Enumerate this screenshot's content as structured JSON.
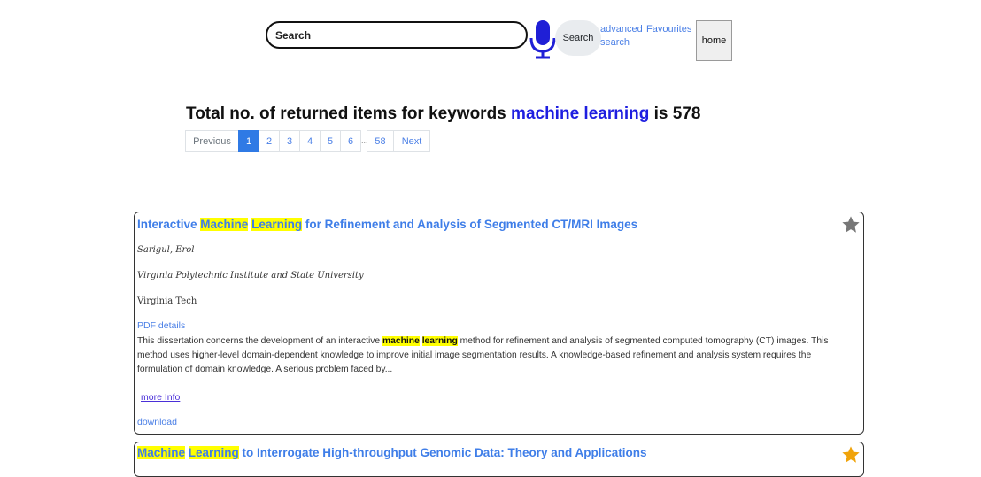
{
  "search": {
    "placeholder": "Search",
    "button_label": "Search"
  },
  "nav": {
    "advanced_search": "advanced search",
    "favourites": "Favourites",
    "home": "home"
  },
  "summary": {
    "prefix": "Total no. of returned items for keywords",
    "keyword": "machine learning",
    "connector": "is",
    "count": "578"
  },
  "pagination": {
    "previous": "Previous",
    "pages": [
      "1",
      "2",
      "3",
      "4",
      "5",
      "6"
    ],
    "ellipsis": "...",
    "last": "58",
    "next": "Next",
    "active_page": "1"
  },
  "results": [
    {
      "title_parts": [
        "Interactive ",
        "Machine",
        " ",
        "Learning",
        " for Refinement and Analysis of Segmented CT/MRI Images"
      ],
      "favourite": false,
      "author": "Sarigul, Erol",
      "institution": "Virginia Polytechnic Institute and State University",
      "publisher": "Virginia Tech",
      "pdf_label": "PDF details",
      "abstract_parts": [
        "This dissertation concerns the development of an interactive ",
        "machine",
        " ",
        "learning",
        " method for refinement and analysis of segmented computed tomography (CT) images. This method uses higher-level domain-dependent knowledge to improve initial image segmentation results. A knowledge-based refinement and analysis system requires the formulation of domain knowledge. A serious problem faced by..."
      ],
      "more_info": "more Info",
      "download": "download"
    },
    {
      "title_parts": [
        "Machine",
        " ",
        "Learning",
        " to Interrogate High-throughput Genomic Data: Theory and Applications"
      ],
      "favourite": true
    }
  ],
  "colors": {
    "link": "#4a7fe6",
    "keyword": "#1e1ee0",
    "highlight": "#ffff00",
    "active_page": "#2f7ae5",
    "mic": "#1f1fd6",
    "star_off": "#777777",
    "star_on": "#f0a30a"
  },
  "icons": {
    "mic": "microphone-icon",
    "star": "star-icon"
  }
}
